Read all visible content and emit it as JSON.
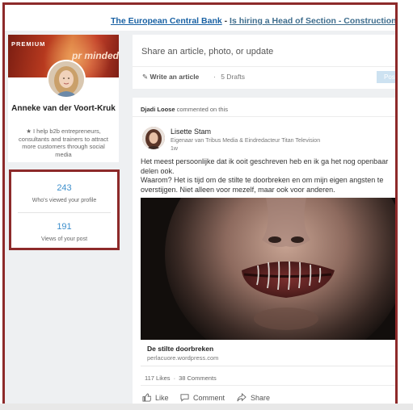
{
  "ad": {
    "company": "The European Central Bank",
    "separator": " - ",
    "job": "Is hiring a Head of Section - Construction Project Mana"
  },
  "profile": {
    "premium_label": "PREMIUM",
    "cover_brand": "pr minded",
    "name": "Anneke van der Voort-Kruk",
    "headline": "★ I help b2b entrepreneurs, consultants and trainers to attract more customers through social media"
  },
  "stats": {
    "profile_views": "243",
    "profile_views_label": "Who's viewed your profile",
    "post_views": "191",
    "post_views_label": "Views of your post"
  },
  "share": {
    "placeholder": "Share an article, photo, or update",
    "write_article": "Write an article",
    "drafts": "5 Drafts",
    "post_button": "Post"
  },
  "feed": {
    "activity_actor": "Djadi Loose",
    "activity_text": " commented on this",
    "author_name": "Lisette Stam",
    "author_title": "Eigenaar van Tribus Media & Eindredacteur Titan Television",
    "post_time": "1w",
    "post_text": "Het meest persoonlijke dat ik ooit geschreven heb en ik ga het nog openbaar delen ook.\nWaarom? Het is tijd om de stilte te doorbreken en om mijn eigen angsten te overstijgen. Niet alleen voor mezelf, maar ook voor anderen.",
    "link_title": "De stilte doorbreken",
    "link_url": "perlacuore.wordpress.com",
    "likes": "117 Likes",
    "comments": "38 Comments",
    "actions": {
      "like": "Like",
      "comment": "Comment",
      "share": "Share"
    }
  },
  "colors": {
    "highlight_border": "#8d2a2a",
    "link_blue": "#3d8fcc"
  }
}
